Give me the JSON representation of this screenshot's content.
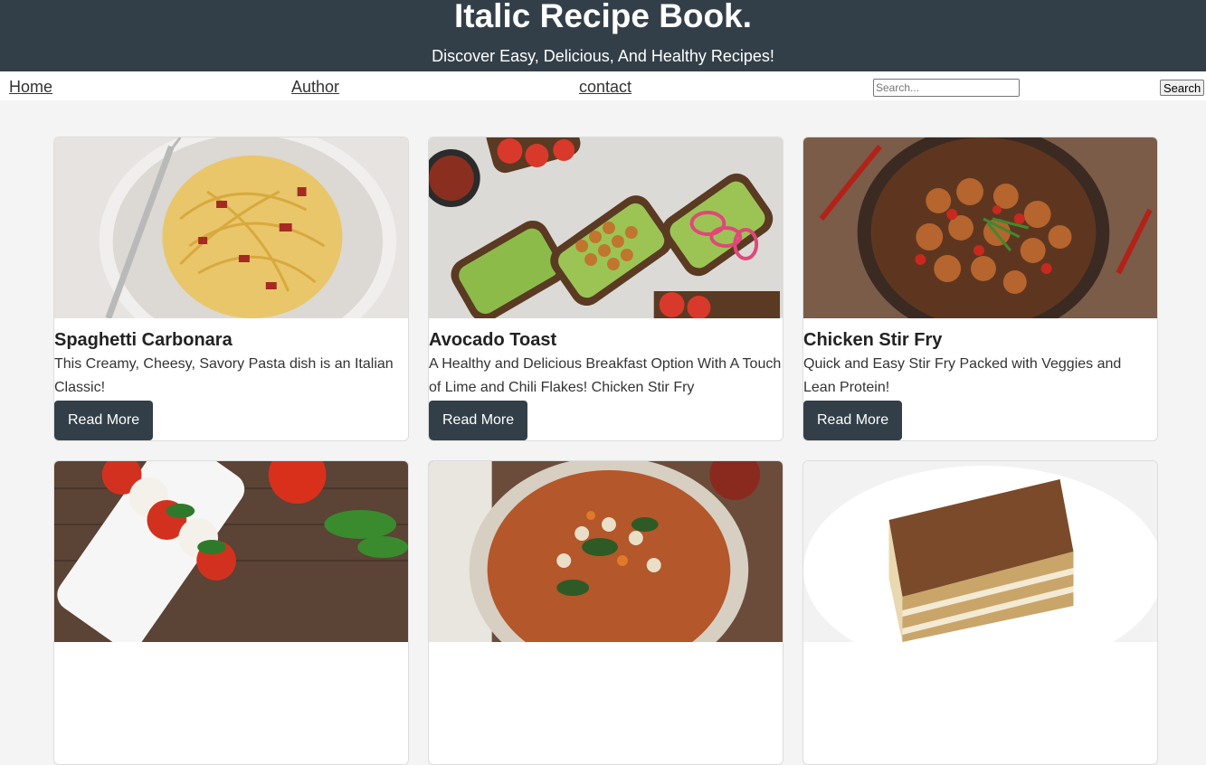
{
  "site": {
    "title": "Italic Recipe Book.",
    "subtitle": "Discover Easy, Delicious, And Healthy Recipes!"
  },
  "nav": {
    "links": [
      "Home",
      "Author",
      "contact"
    ],
    "search_placeholder": "Search...",
    "search_button": "Search"
  },
  "recipes": [
    {
      "title": "Spaghetti Carbonara",
      "description": "This Creamy, Cheesy, Savory Pasta dish is an Italian Classic!",
      "button": "Read More"
    },
    {
      "title": "Avocado Toast",
      "description": "A Healthy and Delicious Breakfast Option With A Touch of Lime and Chili Flakes! Chicken Stir Fry",
      "button": "Read More"
    },
    {
      "title": "Chicken Stir Fry",
      "description": "Quick and Easy Stir Fry Packed with Veggies and Lean Protein!",
      "button": "Read More"
    }
  ],
  "colors": {
    "header_bg": "#333f48",
    "button_bg": "#333f48",
    "page_bg": "#f4f4f4"
  }
}
